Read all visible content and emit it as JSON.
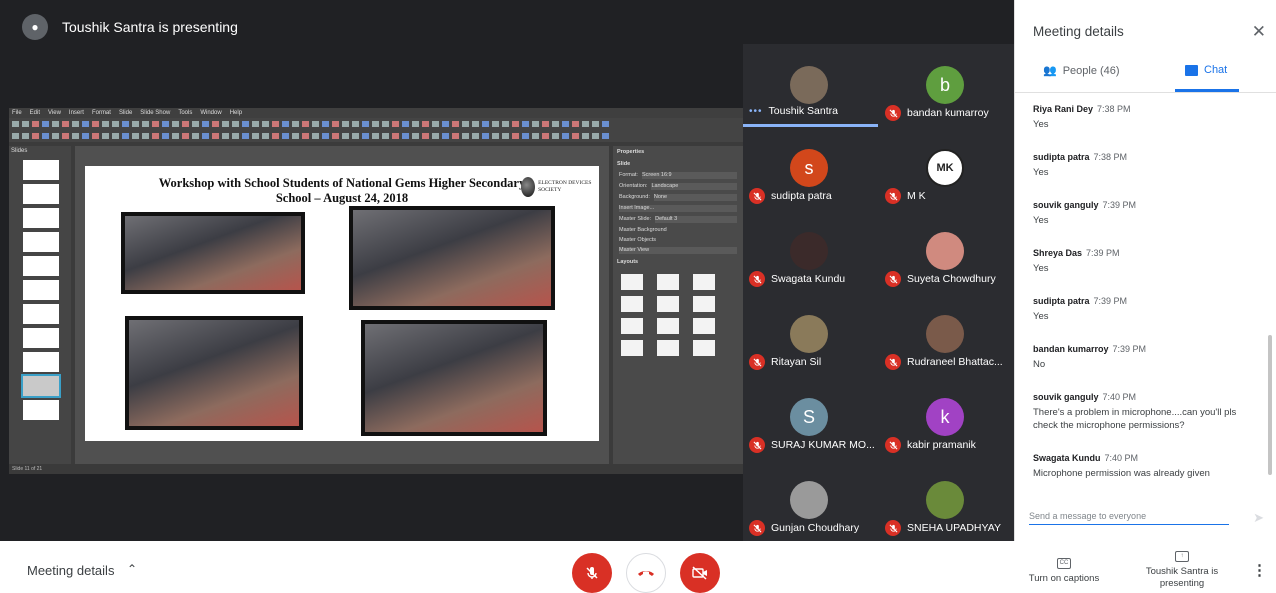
{
  "banner": {
    "text": "Toushik Santra is presenting"
  },
  "shared_screen": {
    "menu": [
      "File",
      "Edit",
      "View",
      "Insert",
      "Format",
      "Slide",
      "Slide Show",
      "Tools",
      "Window",
      "Help"
    ],
    "slides_label": "Slides",
    "slide_title": "Workshop with School Students of National Gems Higher Secondary School – August 24, 2018",
    "logo_text": "ELECTRON DEVICES SOCIETY",
    "properties_label": "Properties",
    "slide_label": "Slide",
    "format_label": "Format:",
    "format_value": "Screen 16:9",
    "orientation_label": "Orientation:",
    "orientation_value": "Landscape",
    "background_label": "Background:",
    "background_value": "None",
    "insert_image": "Insert Image...",
    "master_slide_label": "Master Slide:",
    "master_slide_value": "Default 3",
    "master_background": "Master Background",
    "master_objects": "Master Objects",
    "master_view": "Master View",
    "layouts_label": "Layouts",
    "status": "Slide 11 of 21"
  },
  "participants": [
    {
      "name": "Toushik Santra",
      "initial": "",
      "color": "#7a6a5a",
      "muted": false,
      "speaking": true
    },
    {
      "name": "bandan kumarroy",
      "initial": "b",
      "color": "#5f9e3f",
      "muted": true
    },
    {
      "name": "sudipta patra",
      "initial": "s",
      "color": "#d2471b",
      "muted": true
    },
    {
      "name": "M K",
      "initial": "MK",
      "color": "#ffffff",
      "muted": true
    },
    {
      "name": "Swagata Kundu",
      "initial": "",
      "color": "#3b2a2a",
      "muted": true
    },
    {
      "name": "Suyeta Chowdhury",
      "initial": "",
      "color": "#d08a7f",
      "muted": true
    },
    {
      "name": "Ritayan Sil",
      "initial": "",
      "color": "#8a7a5a",
      "muted": true
    },
    {
      "name": "Rudraneel Bhattac...",
      "initial": "",
      "color": "#7a5a4a",
      "muted": true
    },
    {
      "name": "SURAJ KUMAR MO...",
      "initial": "S",
      "color": "#6b8ea0",
      "muted": true
    },
    {
      "name": "kabir pramanik",
      "initial": "k",
      "color": "#a142c4",
      "muted": true
    },
    {
      "name": "Gunjan Choudhary",
      "initial": "",
      "color": "#9a9a9a",
      "muted": true
    },
    {
      "name": "SNEHA UPADHYAY",
      "initial": "",
      "color": "#6a8a3a",
      "muted": true
    }
  ],
  "panel": {
    "title": "Meeting details",
    "people_tab": "People (46)",
    "chat_tab": "Chat",
    "composer_placeholder": "Send a message to everyone"
  },
  "chat": [
    {
      "sender": "Riya Rani Dey",
      "time": "7:38 PM",
      "text": "Yes"
    },
    {
      "sender": "sudipta patra",
      "time": "7:38 PM",
      "text": "Yes"
    },
    {
      "sender": "souvik ganguly",
      "time": "7:39 PM",
      "text": "Yes"
    },
    {
      "sender": "Shreya Das",
      "time": "7:39 PM",
      "text": "Yes"
    },
    {
      "sender": "sudipta patra",
      "time": "7:39 PM",
      "text": "Yes"
    },
    {
      "sender": "bandan kumarroy",
      "time": "7:39 PM",
      "text": "No"
    },
    {
      "sender": "souvik ganguly",
      "time": "7:40 PM",
      "text": "There's a problem in microphone....can you'll pls check the microphone permissions?"
    },
    {
      "sender": "Swagata Kundu",
      "time": "7:40 PM",
      "text": "Microphone permission was already given"
    }
  ],
  "bottom_bar": {
    "meeting_details": "Meeting details",
    "captions": "Turn on captions",
    "captions_icon": "CC",
    "presenting": "Toushik Santra is presenting"
  }
}
